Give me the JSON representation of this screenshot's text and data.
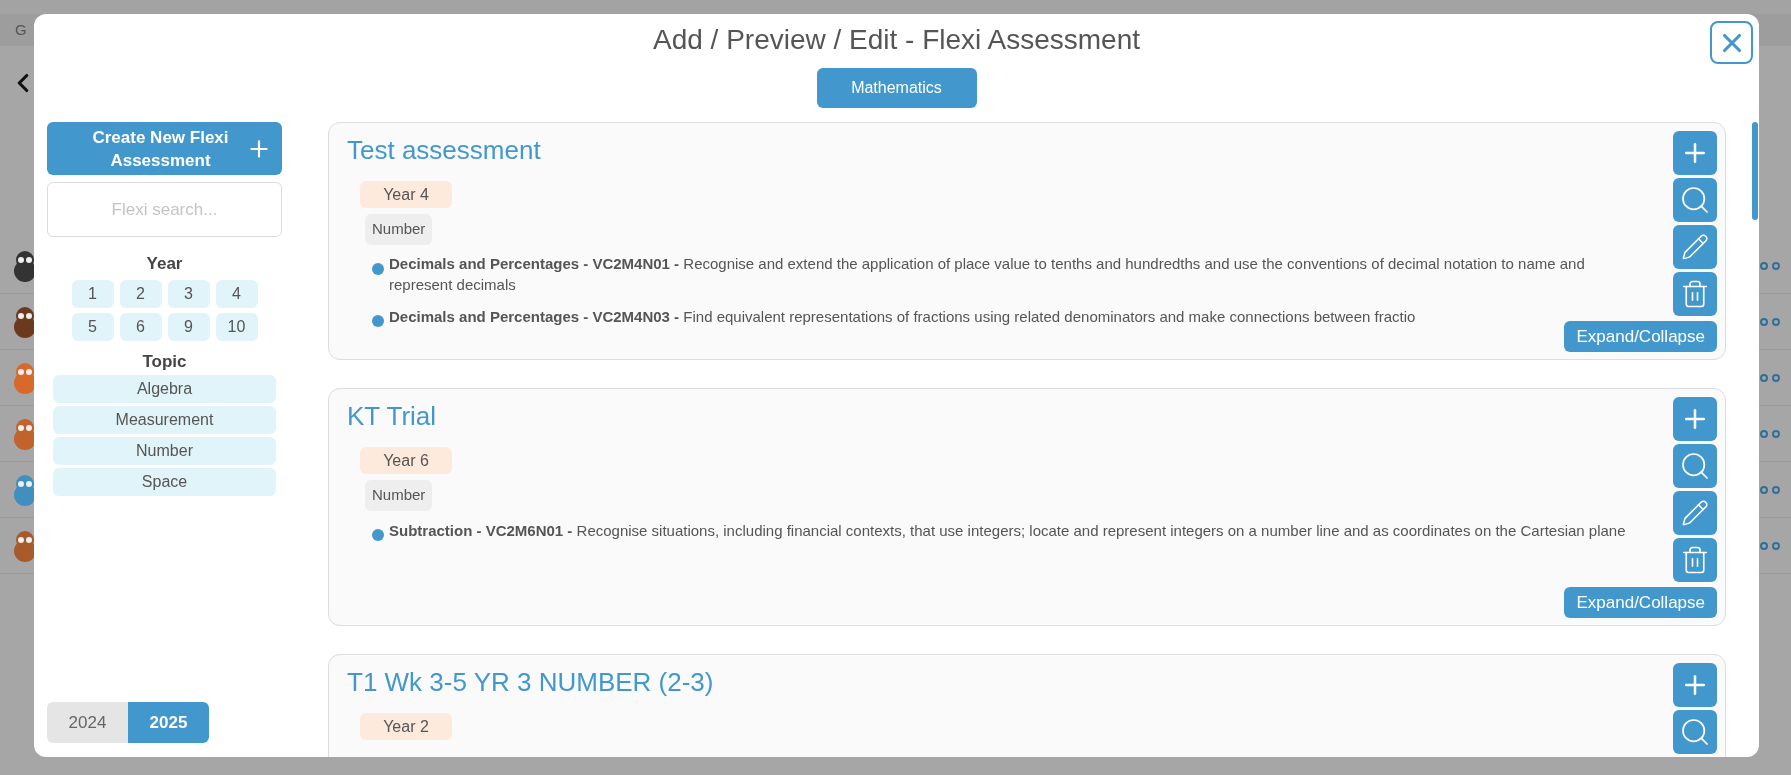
{
  "background": {
    "tab_label": "G"
  },
  "dialog": {
    "title": "Add / Preview / Edit - Flexi Assessment",
    "subject": "Mathematics",
    "create_button": "Create New Flexi Assessment",
    "search": {
      "placeholder": "Flexi search..."
    },
    "year_filter": {
      "label": "Year",
      "options": [
        {
          "label": "1",
          "selected": false
        },
        {
          "label": "2",
          "selected": false
        },
        {
          "label": "3",
          "selected": false
        },
        {
          "label": "4",
          "selected": false
        },
        {
          "label": "5",
          "selected": false
        },
        {
          "label": "6",
          "selected": false
        },
        {
          "label": "9",
          "selected": false
        },
        {
          "label": "10",
          "selected": false
        }
      ]
    },
    "topic_filter": {
      "label": "Topic",
      "options": [
        {
          "label": "Algebra",
          "selected": false
        },
        {
          "label": "Measurement",
          "selected": false
        },
        {
          "label": "Number",
          "selected": false
        },
        {
          "label": "Space",
          "selected": false
        }
      ]
    },
    "school_years": [
      {
        "label": "2024",
        "selected": false
      },
      {
        "label": "2025",
        "selected": true
      }
    ],
    "assessments": [
      {
        "title": "Test assessment",
        "year": "Year 4",
        "topic": "Number",
        "outcomes": [
          "**Decimals and Percentages - VC2M4N01 -** Recognise and extend the application of place value to tenths and hundredths and use the conventions of decimal notation to name and represent decimals",
          "**Decimals and Percentages - VC2M4N03 -** Find equivalent representations of fractions using related denominators and make connections between fractio"
        ],
        "actions": [
          {
            "kind": "add"
          },
          {
            "kind": "search"
          },
          {
            "kind": "edit"
          },
          {
            "kind": "delete"
          }
        ],
        "expand_label": "Expand/Collapse"
      },
      {
        "title": "KT Trial",
        "year": "Year 6",
        "topic": "Number",
        "outcomes": [
          "**Subtraction - VC2M6N01 -** Recognise situations, including financial contexts, that use integers; locate and represent integers on a number line and as coordinates on the Cartesian plane"
        ],
        "actions": [
          {
            "kind": "add"
          },
          {
            "kind": "search"
          },
          {
            "kind": "edit"
          },
          {
            "kind": "delete"
          }
        ],
        "expand_label": "Expand/Collapse"
      },
      {
        "title": "T1 Wk 3-5 YR 3 NUMBER (2-3)",
        "year": "Year 2",
        "actions": [
          {
            "kind": "add"
          },
          {
            "kind": "search"
          }
        ]
      }
    ]
  }
}
